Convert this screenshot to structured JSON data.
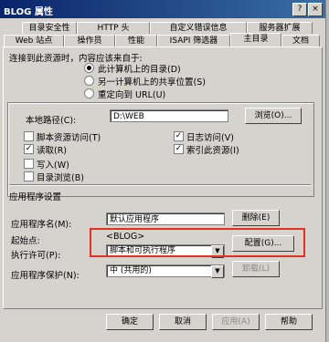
{
  "window": {
    "title": "BLOG 属性",
    "help_btn": "?",
    "close_btn": "×"
  },
  "tabs_row1": [
    "目录安全性",
    "HTTP 头",
    "自定义错误信息",
    "服务器扩展"
  ],
  "tabs_row2": [
    "Web 站点",
    "操作员",
    "性能",
    "ISAPI 筛选器",
    "主目录",
    "文档"
  ],
  "content_source": {
    "prompt": "连接到此资源时，内容应该来自于:",
    "options": [
      "此计算机上的目录(D)",
      "另一计算机上的共享位置(S)",
      "重定向到 URL(U)"
    ],
    "selected_index": 0
  },
  "local_path": {
    "label": "本地路径(C):",
    "value": "D:\\WEB",
    "browse_button": "浏览(O)..."
  },
  "checkboxes": {
    "script_source_access": {
      "label": "脚本资源访问(T)",
      "checked": false
    },
    "read": {
      "label": "读取(R)",
      "checked": true
    },
    "write": {
      "label": "写入(W)",
      "checked": false
    },
    "directory_browsing": {
      "label": "目录浏览(B)",
      "checked": false
    },
    "log_visits": {
      "label": "日志访问(V)",
      "checked": true
    },
    "index_resource": {
      "label": "索引此资源(I)",
      "checked": true
    }
  },
  "app_settings": {
    "heading": "应用程序设置",
    "app_name_label": "应用程序名(M):",
    "app_name_value": "默认应用程序",
    "remove_button": "删除(E)",
    "start_point_label": "起始点:",
    "start_point_value": "<BLOG>",
    "exec_perm_label": "执行许可(P):",
    "exec_perm_value": "脚本和可执行程序",
    "config_button": "配置(G)...",
    "protection_label": "应用程序保护(N):",
    "protection_value": "中 (共用的)",
    "unload_button": "卸载(L)"
  },
  "footer": {
    "ok": "确定",
    "cancel": "取消",
    "apply": "应用(A)",
    "help": "帮助"
  },
  "colors": {
    "highlight": "#e0301e",
    "title_bar": "#0a246a",
    "face": "#d6d3ce"
  }
}
